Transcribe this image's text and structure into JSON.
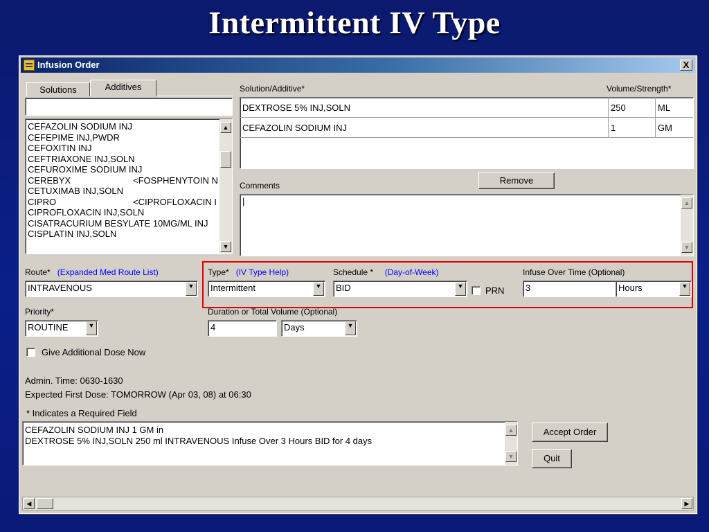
{
  "slide": {
    "title": "Intermittent IV Type"
  },
  "window": {
    "title": "Infusion Order",
    "close_glyph": "X"
  },
  "tabs": [
    {
      "label": "Solutions",
      "active": false
    },
    {
      "label": "Additives",
      "active": true
    }
  ],
  "additives": {
    "search_value": "",
    "items": [
      {
        "name": "CEFAZOLIN SODIUM INJ",
        "alias": ""
      },
      {
        "name": "CEFEPIME INJ,PWDR",
        "alias": ""
      },
      {
        "name": "CEFOXITIN INJ",
        "alias": ""
      },
      {
        "name": "CEFTRIAXONE INJ,SOLN",
        "alias": ""
      },
      {
        "name": "CEFUROXIME SODIUM INJ",
        "alias": ""
      },
      {
        "name": "CEREBYX",
        "alias": "<FOSPHENYTOIN N"
      },
      {
        "name": "CETUXIMAB INJ,SOLN",
        "alias": ""
      },
      {
        "name": "CIPRO",
        "alias": "<CIPROFLOXACIN I"
      },
      {
        "name": "CIPROFLOXACIN INJ,SOLN",
        "alias": ""
      },
      {
        "name": "CISATRACURIUM BESYLATE 10MG/ML INJ",
        "alias": ""
      },
      {
        "name": "CISPLATIN INJ,SOLN",
        "alias": ""
      }
    ]
  },
  "solution_grid": {
    "header_left": "Solution/Additive*",
    "header_right": "Volume/Strength*",
    "rows": [
      {
        "name": "DEXTROSE 5% INJ,SOLN",
        "amount": "250",
        "unit": "ML"
      },
      {
        "name": "CEFAZOLIN SODIUM INJ",
        "amount": "1",
        "unit": "GM"
      }
    ]
  },
  "remove_label": "Remove",
  "comments": {
    "label": "Comments",
    "value": "|"
  },
  "route": {
    "label": "Route*",
    "link": "(Expanded Med Route List)",
    "value": "INTRAVENOUS"
  },
  "type": {
    "label": "Type*",
    "link": "(IV Type Help)",
    "value": "Intermittent"
  },
  "schedule": {
    "label": "Schedule *",
    "link": "(Day-of-Week)",
    "value": "BID",
    "prn_label": "PRN",
    "prn_checked": false
  },
  "infuse": {
    "label": "Infuse Over Time (Optional)",
    "value": "3",
    "unit": "Hours"
  },
  "priority": {
    "label": "Priority*",
    "value": "ROUTINE"
  },
  "duration": {
    "label": "Duration or Total Volume (Optional)",
    "value": "4",
    "unit": "Days"
  },
  "give_dose": {
    "label": "Give Additional Dose Now",
    "checked": false
  },
  "admin_time": "Admin. Time: 0630-1630",
  "first_dose": "Expected First Dose: TOMORROW (Apr 03, 08) at 06:30",
  "required_note": "* Indicates a Required Field",
  "order_summary": [
    "CEFAZOLIN SODIUM INJ  1 GM in",
    "DEXTROSE 5% INJ,SOLN  250 ml INTRAVENOUS  Infuse Over 3 Hours  BID for 4 days"
  ],
  "accept_label": "Accept Order",
  "quit_label": "Quit",
  "icons": {
    "scroll_up": "▲",
    "scroll_down": "▼",
    "scroll_left": "◀",
    "scroll_right": "▶",
    "combo": "▼"
  },
  "colors": {
    "highlight": "#e00000",
    "link": "#0000ff",
    "titlebar": "#0a246a"
  }
}
